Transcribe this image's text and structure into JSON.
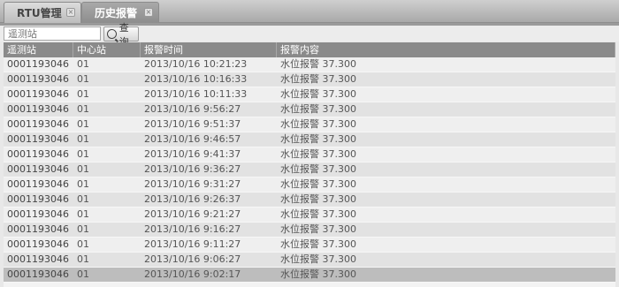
{
  "tabs": [
    {
      "label": "RTU管理",
      "close": "×"
    },
    {
      "label": "历史报警",
      "close": "×"
    }
  ],
  "search": {
    "placeholder": "遥测站",
    "button_label": "查询"
  },
  "table": {
    "headers": [
      "遥测站",
      "中心站",
      "报警时间",
      "报警内容"
    ],
    "rows": [
      [
        "0001193046",
        "01",
        "2013/10/16 10:21:23",
        "水位报警 37.300"
      ],
      [
        "0001193046",
        "01",
        "2013/10/16 10:16:33",
        "水位报警 37.300"
      ],
      [
        "0001193046",
        "01",
        "2013/10/16 10:11:33",
        "水位报警 37.300"
      ],
      [
        "0001193046",
        "01",
        "2013/10/16 9:56:27",
        "水位报警 37.300"
      ],
      [
        "0001193046",
        "01",
        "2013/10/16 9:51:37",
        "水位报警 37.300"
      ],
      [
        "0001193046",
        "01",
        "2013/10/16 9:46:57",
        "水位报警 37.300"
      ],
      [
        "0001193046",
        "01",
        "2013/10/16 9:41:37",
        "水位报警 37.300"
      ],
      [
        "0001193046",
        "01",
        "2013/10/16 9:36:27",
        "水位报警 37.300"
      ],
      [
        "0001193046",
        "01",
        "2013/10/16 9:31:27",
        "水位报警 37.300"
      ],
      [
        "0001193046",
        "01",
        "2013/10/16 9:26:37",
        "水位报警 37.300"
      ],
      [
        "0001193046",
        "01",
        "2013/10/16 9:21:27",
        "水位报警 37.300"
      ],
      [
        "0001193046",
        "01",
        "2013/10/16 9:16:27",
        "水位报警 37.300"
      ],
      [
        "0001193046",
        "01",
        "2013/10/16 9:11:27",
        "水位报警 37.300"
      ],
      [
        "0001193046",
        "01",
        "2013/10/16 9:06:27",
        "水位报警 37.300"
      ],
      [
        "0001193046",
        "01",
        "2013/10/16 9:02:17",
        "水位报警 37.300"
      ]
    ]
  }
}
